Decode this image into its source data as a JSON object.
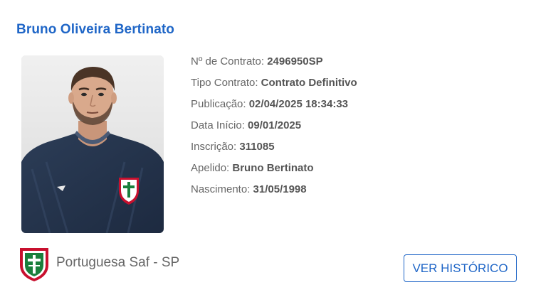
{
  "player": {
    "name": "Bruno Oliveira Bertinato"
  },
  "details": [
    {
      "label": "Nº de Contrato: ",
      "value": "2496950SP"
    },
    {
      "label": "Tipo Contrato: ",
      "value": "Contrato Definitivo"
    },
    {
      "label": "Publicação: ",
      "value": "02/04/2025 18:34:33"
    },
    {
      "label": "Data Início: ",
      "value": "09/01/2025"
    },
    {
      "label": "Inscrição: ",
      "value": "311085"
    },
    {
      "label": "Apelido: ",
      "value": "Bruno Bertinato"
    },
    {
      "label": "Nascimento: ",
      "value": "31/05/1998"
    }
  ],
  "club": {
    "name": "Portuguesa Saf - SP",
    "crest_icon": "portuguesa-crest-icon"
  },
  "actions": {
    "history_label": "VER HISTÓRICO"
  },
  "colors": {
    "accent": "#1f66c7",
    "text": "#555555",
    "crest_red": "#c8102e",
    "crest_green": "#1a7f3c"
  }
}
